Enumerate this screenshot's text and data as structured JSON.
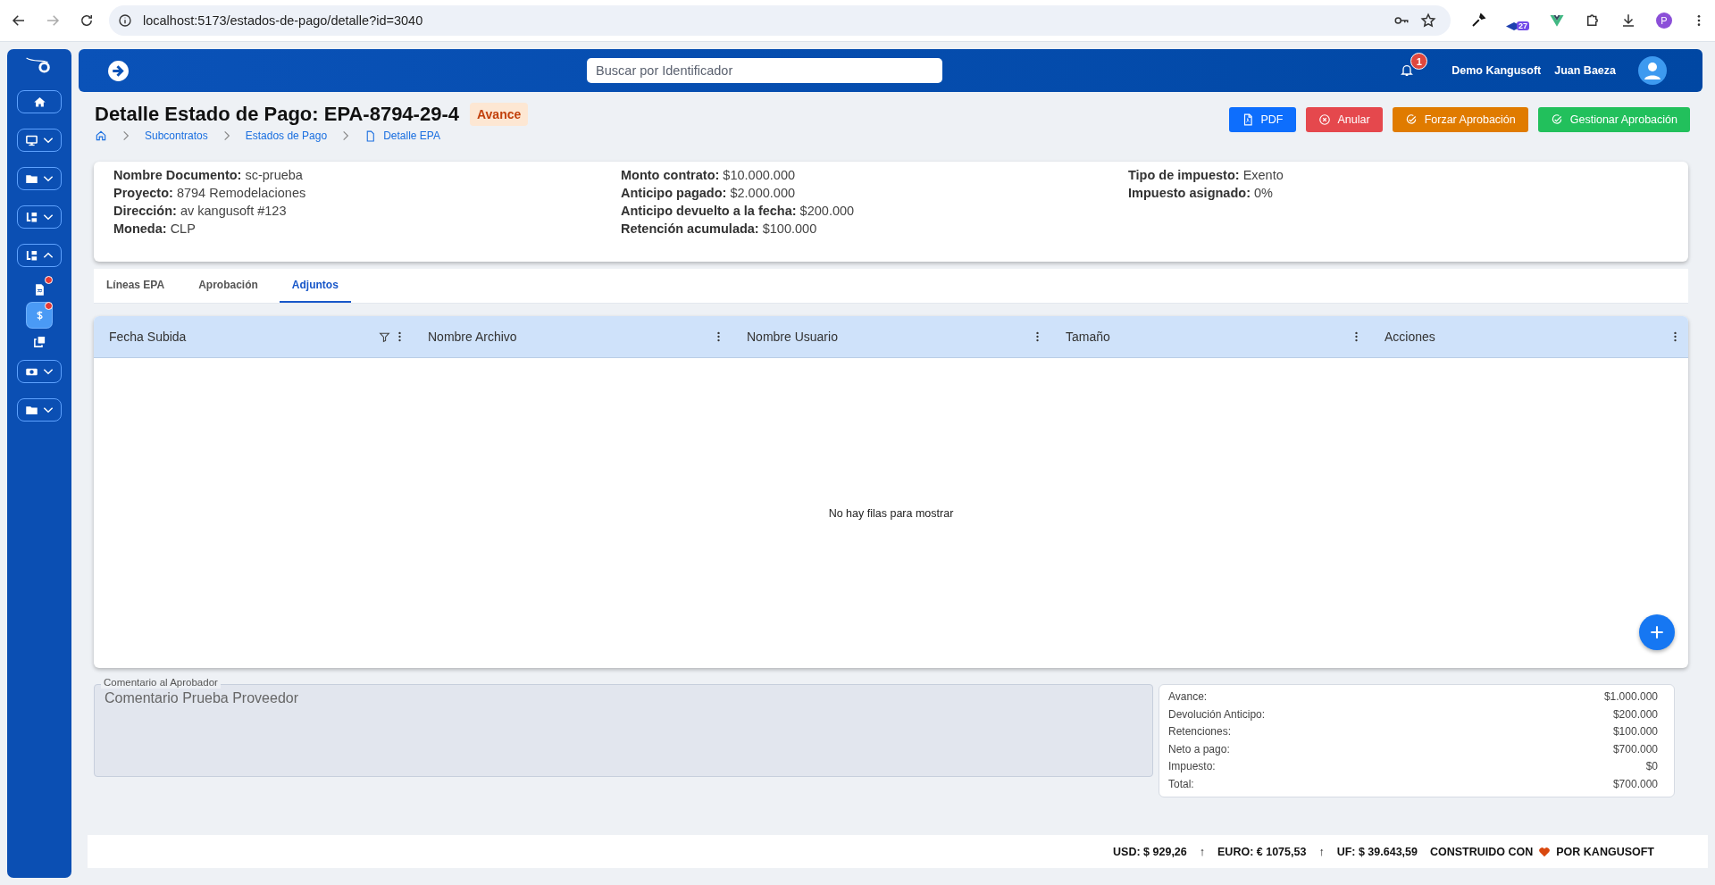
{
  "browser": {
    "url": "localhost:5173/estados-de-pago/detalle?id=3040",
    "extension_badge": "27",
    "profile_initial": "P"
  },
  "sidebar": {
    "items": [
      {
        "kind": "button"
      },
      {
        "kind": "group",
        "expanded": false
      },
      {
        "kind": "group",
        "expanded": false
      },
      {
        "kind": "group",
        "expanded": false
      },
      {
        "kind": "group",
        "expanded": true
      },
      {
        "kind": "link",
        "selected": false,
        "notified": true
      },
      {
        "kind": "link",
        "selected": true,
        "notified": true
      },
      {
        "kind": "link",
        "selected": false,
        "notified": false
      },
      {
        "kind": "group",
        "expanded": false
      },
      {
        "kind": "group",
        "expanded": false
      }
    ]
  },
  "header": {
    "search": {
      "placeholder": "Buscar por Identificador"
    },
    "notifications": "1",
    "company": "Demo Kangusoft",
    "user": "Juan Baeza"
  },
  "page": {
    "title": "Detalle Estado de Pago: EPA-8794-29-4",
    "status": "Avance",
    "breadcrumb": [
      "Subcontratos",
      "Estados de Pago",
      "Detalle EPA"
    ],
    "actions": [
      {
        "label": "PDF",
        "kind": "primary"
      },
      {
        "label": "Anular",
        "kind": "danger"
      },
      {
        "label": "Forzar Aprobación",
        "kind": "warning"
      },
      {
        "label": "Gestionar Aprobación",
        "kind": "success"
      }
    ]
  },
  "info": {
    "columns": [
      [
        {
          "label": "Nombre Documento:",
          "value": "sc-prueba"
        },
        {
          "label": "Proyecto:",
          "value": "8794 Remodelaciones"
        },
        {
          "label": "Dirección:",
          "value": "av kangusoft #123"
        },
        {
          "label": "Moneda:",
          "value": "CLP"
        }
      ],
      [
        {
          "label": "Monto contrato:",
          "value": "$10.000.000"
        },
        {
          "label": "Anticipo pagado:",
          "value": "$2.000.000"
        },
        {
          "label": "Anticipo devuelto a la fecha:",
          "value": "$200.000"
        },
        {
          "label": "Retención acumulada:",
          "value": "$100.000"
        }
      ],
      [
        {
          "label": "Tipo de impuesto:",
          "value": "Exento"
        },
        {
          "label": "Impuesto asignado:",
          "value": "0%"
        }
      ]
    ]
  },
  "tabs": [
    {
      "label": "Líneas EPA",
      "selected": false
    },
    {
      "label": "Aprobación",
      "selected": false
    },
    {
      "label": "Adjuntos",
      "selected": true
    }
  ],
  "table": {
    "columns": [
      {
        "label": "Fecha Subida",
        "filter": true
      },
      {
        "label": "Nombre Archivo",
        "filter": false
      },
      {
        "label": "Nombre Usuario",
        "filter": false
      },
      {
        "label": "Tamaño",
        "filter": false
      },
      {
        "label": "Acciones",
        "filter": false
      }
    ],
    "empty_message": "No hay filas para mostrar"
  },
  "comment": {
    "label": "Comentario al Aprobador",
    "value": "Comentario Prueba Proveedor"
  },
  "totals": [
    {
      "label": "Avance:",
      "value": "$1.000.000"
    },
    {
      "label": "Devolución Anticipo:",
      "value": "$200.000"
    },
    {
      "label": "Retenciones:",
      "value": "$100.000"
    },
    {
      "label": "Neto a pago:",
      "value": "$700.000"
    },
    {
      "label": "Impuesto:",
      "value": "$0"
    },
    {
      "label": "Total:",
      "value": "$700.000"
    }
  ],
  "footer": {
    "rates": [
      {
        "text": "USD: $ 929,26",
        "arrow": "↑"
      },
      {
        "text": "EURO: € 1075,53",
        "arrow": "↑"
      },
      {
        "text": "UF: $ 39.643,59"
      }
    ],
    "credit": {
      "before": "CONSTRUIDO CON",
      "after": "POR KANGUSOFT"
    }
  }
}
